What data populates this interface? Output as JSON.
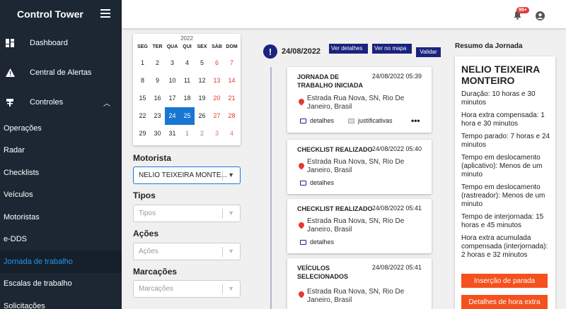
{
  "sidebar": {
    "brand": "Control Tower",
    "items": [
      {
        "label": "Dashboard",
        "icon": "dashboard-icon"
      },
      {
        "label": "Central de Alertas",
        "icon": "warning-icon"
      },
      {
        "label": "Controles",
        "icon": "controls-icon"
      }
    ],
    "subitems": [
      "Operações",
      "Radar",
      "Checklists",
      "Veículos",
      "Motoristas",
      "e-DDS",
      "Jornada de trabalho",
      "Escalas de trabalho",
      "Solicitações"
    ],
    "active_subitem": "Jornada de trabalho"
  },
  "topbar": {
    "badge": "99+"
  },
  "calendar": {
    "year": "2022",
    "weekdays": [
      "SEG",
      "TER",
      "QUA",
      "QUI",
      "SEX",
      "SÁB",
      "DOM"
    ],
    "weeks": [
      [
        "1",
        "2",
        "3",
        "4",
        "5",
        "6",
        "7"
      ],
      [
        "8",
        "9",
        "10",
        "11",
        "12",
        "13",
        "14"
      ],
      [
        "15",
        "16",
        "17",
        "18",
        "19",
        "20",
        "21"
      ],
      [
        "22",
        "23",
        "24",
        "25",
        "26",
        "27",
        "28"
      ],
      [
        "29",
        "30",
        "31",
        "1",
        "2",
        "3",
        "4"
      ]
    ],
    "selected": [
      "24",
      "25"
    ]
  },
  "filters": {
    "motorista_label": "Motorista",
    "motorista_value": "NELIO TEIXEIRA MONTE...",
    "tipos_label": "Tipos",
    "tipos_placeholder": "Tipos",
    "acoes_label": "Ações",
    "acoes_placeholder": "Ações",
    "marcacoes_label": "Marcações",
    "marcacoes_placeholder": "Marcações"
  },
  "timeline": {
    "date": "24/08/2022",
    "btn_detalhes": "Ver detalhes",
    "btn_mapa": "Ver no mapa",
    "btn_validar": "Validar",
    "cards": [
      {
        "title": "JORNADA DE TRABALHO INICIADA",
        "date": "24/08/2022 05:39",
        "address": "Estrada Rua Nova, SN, Rio De Janeiro, Brasil",
        "detalhes": "detalhes",
        "justificativas": "justificativas",
        "more": "•••"
      },
      {
        "title": "CHECKLIST REALIZADO",
        "date": "24/08/2022 05:40",
        "address": "Estrada Rua Nova, SN, Rio De Janeiro, Brasil",
        "detalhes": "detalhes"
      },
      {
        "title": "CHECKLIST REALIZADO",
        "date": "24/08/2022 05:41",
        "address": "Estrada Rua Nova, SN, Rio De Janeiro, Brasil",
        "detalhes": "detalhes"
      },
      {
        "title": "VEÍCULOS SELECIONADOS",
        "date": "24/08/2022 05:41",
        "address": "Estrada Rua Nova, SN, Rio De Janeiro, Brasil"
      }
    ]
  },
  "summary": {
    "title": "Resumo da Jornada",
    "name": "NELIO TEIXEIRA MONTEIRO",
    "lines": [
      "Duração: 10 horas e 30 minutos",
      "Hora extra compensada: 1 hora e 30 minutos",
      "Tempo parado: 7 horas e 24 minutos",
      "Tempo em deslocamento (aplicativo): Menos de um minuto",
      "Tempo em deslocamento (rastreador): Menos de um minuto",
      "Tempo de interjornada: 15 horas e 45 minutos",
      "Hora extra acumulada compensada (interjornada): 2 horas e 32 minutos"
    ],
    "btn_parada": "Inserção de parada",
    "btn_hora_extra": "Detalhes de hora extra"
  },
  "colors": {
    "sidebar_bg": "#1c2733",
    "active": "#2196f3",
    "navy": "#1a237e",
    "accent": "#f4511e",
    "weekend": "#e53935"
  }
}
